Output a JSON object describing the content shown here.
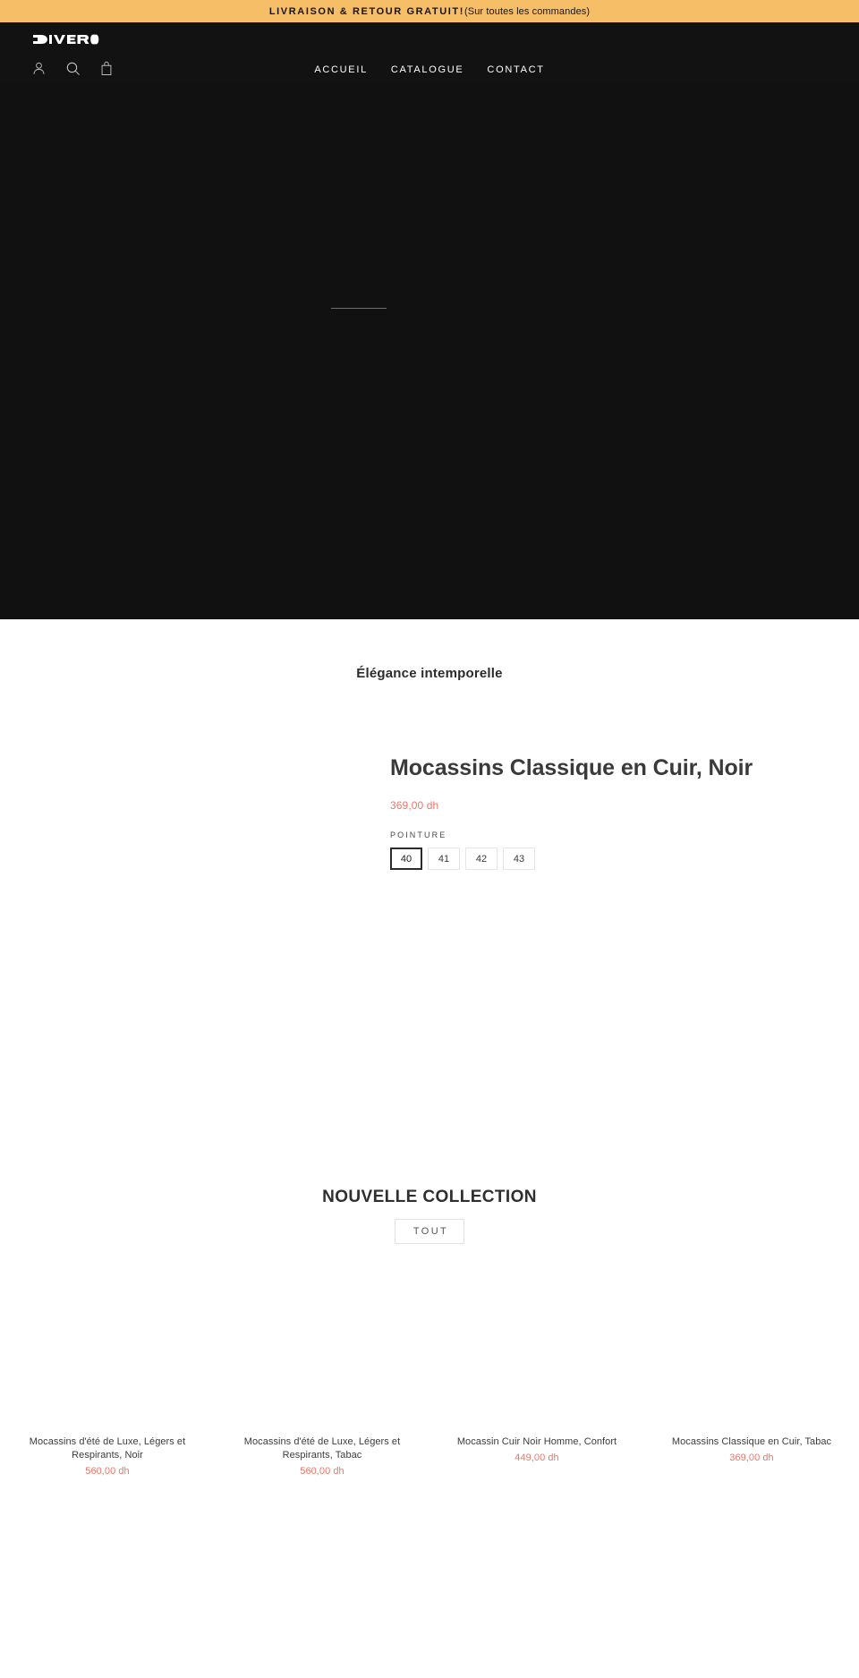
{
  "announcement": {
    "strong_text": "LIVRAISON & RETOUR GRATUIT!",
    "normal_text": "(Sur toutes les commandes)",
    "background_color": "#f7be68",
    "text_color": "#161616"
  },
  "header": {
    "logo_text": "DIVERO",
    "background_color": "#121212",
    "nav": [
      {
        "label": "ACCUEIL"
      },
      {
        "label": "CATALOGUE"
      },
      {
        "label": "CONTACT"
      }
    ],
    "icons": [
      {
        "name": "account-icon"
      },
      {
        "name": "search-icon"
      },
      {
        "name": "bag-icon"
      }
    ]
  },
  "hero": {
    "background_color": "#111111"
  },
  "feature": {
    "heading": "Élégance intemporelle",
    "product": {
      "title": "Mocassins Classique en Cuir, Noir",
      "price": "369,00 dh",
      "price_color": "#e8776a",
      "option_label": "POINTURE",
      "sizes": [
        {
          "value": "40",
          "selected": true
        },
        {
          "value": "41",
          "selected": false
        },
        {
          "value": "42",
          "selected": false
        },
        {
          "value": "43",
          "selected": false
        }
      ]
    }
  },
  "collection": {
    "title": "NOUVELLE COLLECTION",
    "filter_label": "TOUT",
    "products": [
      {
        "name": "Mocassins d'été de Luxe, Légers et Respirants, Noir",
        "price": "560,00 dh"
      },
      {
        "name": "Mocassins d'été de Luxe, Légers et Respirants, Tabac",
        "price": "560,00 dh"
      },
      {
        "name": "Mocassin Cuir Noir Homme, Confort",
        "price": "449,00 dh"
      },
      {
        "name": "Mocassins Classique en Cuir, Tabac",
        "price": "369,00 dh"
      }
    ]
  }
}
